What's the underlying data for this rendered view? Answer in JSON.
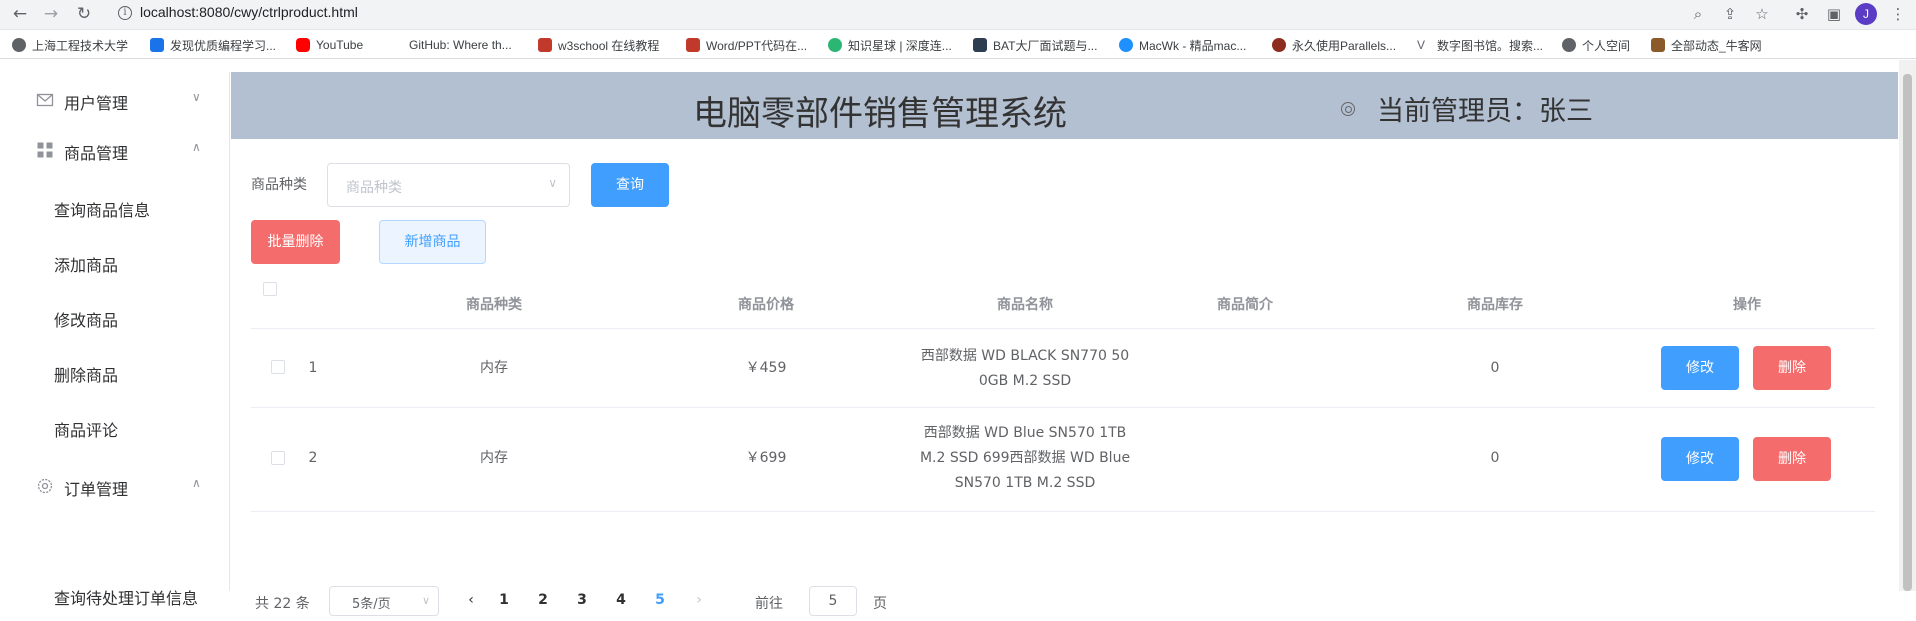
{
  "browser": {
    "url": "localhost:8080/cwy/ctrlproduct.html",
    "avatar_letter": "J",
    "bookmarks": [
      {
        "label": "上海工程技术大学",
        "icon": "globe-icon",
        "color": "#5f6368"
      },
      {
        "label": "发现优质编程学习...",
        "icon": "code-icon",
        "color": "#1a73e8"
      },
      {
        "label": "YouTube",
        "icon": "youtube-icon",
        "color": "#ff0000"
      },
      {
        "label": "GitHub: Where th...",
        "icon": "github-icon",
        "color": "#ffffff"
      },
      {
        "label": "w3school 在线教程",
        "icon": "w3school-icon",
        "color": "#c0392b"
      },
      {
        "label": "Word/PPT代码在...",
        "icon": "document-icon",
        "color": "#c0392b"
      },
      {
        "label": "知识星球 | 深度连...",
        "icon": "planet-icon",
        "color": "#2bb673"
      },
      {
        "label": "BAT大厂面试题与...",
        "icon": "book-icon",
        "color": "#2c3e50"
      },
      {
        "label": "MacWk - 精品mac...",
        "icon": "macwk-icon",
        "color": "#1e90ff"
      },
      {
        "label": "永久使用Parallels...",
        "icon": "parallels-icon",
        "color": "#8e2d1f"
      },
      {
        "label": "数字图书馆。搜索...",
        "icon": "v-icon",
        "color": "#5f6368"
      },
      {
        "label": "个人空间",
        "icon": "globe-icon",
        "color": "#5f6368"
      },
      {
        "label": "全部动态_牛客网",
        "icon": "nowcoder-icon",
        "color": "#8b5a2b"
      }
    ]
  },
  "sidebar": {
    "groups": [
      {
        "label": "用户管理",
        "icon": "mail-icon",
        "arrow": "∨"
      },
      {
        "label": "商品管理",
        "icon": "grid-icon",
        "arrow": "∧"
      },
      {
        "label": "订单管理",
        "icon": "gear-icon",
        "arrow": "∧"
      }
    ],
    "product_items": [
      "查询商品信息",
      "添加商品",
      "修改商品",
      "删除商品",
      "商品评论"
    ],
    "order_items": [
      "查询待处理订单信息"
    ]
  },
  "header": {
    "title": "电脑零部件销售管理系统",
    "admin": "当前管理员：张三"
  },
  "filter": {
    "label": "商品种类",
    "placeholder": "商品种类",
    "query_button": "查询"
  },
  "actions": {
    "batch_delete": "批量删除",
    "add_product": "新增商品"
  },
  "table": {
    "columns": [
      "商品种类",
      "商品价格",
      "商品名称",
      "商品简介",
      "商品库存",
      "操作"
    ],
    "rows": [
      {
        "id": "1",
        "category": "内存",
        "price": "￥459",
        "name_lines": [
          "西部数据 WD BLACK SN770 50",
          "0GB M.2 SSD"
        ],
        "intro": "",
        "stock": "0",
        "edit": "修改",
        "delete": "删除"
      },
      {
        "id": "2",
        "category": "内存",
        "price": "￥699",
        "name_lines": [
          "西部数据 WD Blue SN570 1TB",
          "M.2 SSD 699西部数据 WD Blue",
          "SN570 1TB M.2 SSD"
        ],
        "intro": "",
        "stock": "0",
        "edit": "修改",
        "delete": "删除"
      }
    ]
  },
  "pagination": {
    "total": "共 22 条",
    "page_size": "5条/页",
    "pages": [
      "1",
      "2",
      "3",
      "4",
      "5"
    ],
    "current_page": "5",
    "goto_prefix": "前往",
    "goto_value": "5",
    "goto_suffix": "页"
  }
}
